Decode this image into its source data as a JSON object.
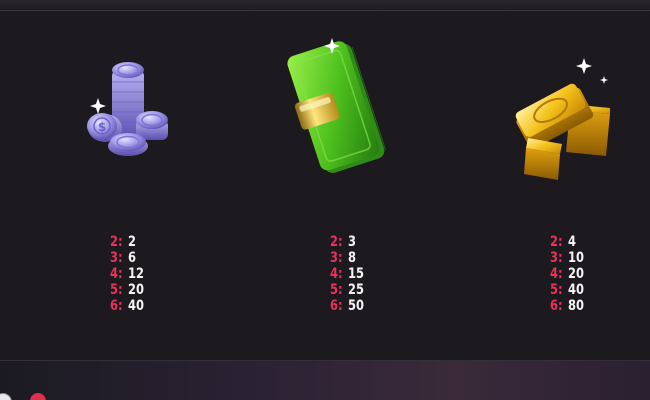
{
  "symbols": [
    {
      "name": "Silver Coins",
      "icon": "silver-coins-icon",
      "payouts": [
        {
          "count": "2:",
          "value": "2"
        },
        {
          "count": "3:",
          "value": "6"
        },
        {
          "count": "4:",
          "value": "12"
        },
        {
          "count": "5:",
          "value": "20"
        },
        {
          "count": "6:",
          "value": "40"
        }
      ]
    },
    {
      "name": "Cash Stack",
      "icon": "cash-stack-icon",
      "payouts": [
        {
          "count": "2:",
          "value": "3"
        },
        {
          "count": "3:",
          "value": "8"
        },
        {
          "count": "4:",
          "value": "15"
        },
        {
          "count": "5:",
          "value": "25"
        },
        {
          "count": "6:",
          "value": "50"
        }
      ]
    },
    {
      "name": "Gold Bars",
      "icon": "gold-bars-icon",
      "payouts": [
        {
          "count": "2:",
          "value": "4"
        },
        {
          "count": "3:",
          "value": "10"
        },
        {
          "count": "4:",
          "value": "20"
        },
        {
          "count": "5:",
          "value": "40"
        },
        {
          "count": "6:",
          "value": "80"
        }
      ]
    }
  ],
  "colors": {
    "background": "#1c1a1e",
    "count_color": "#e8325a",
    "value_color": "#f4f4f4"
  }
}
